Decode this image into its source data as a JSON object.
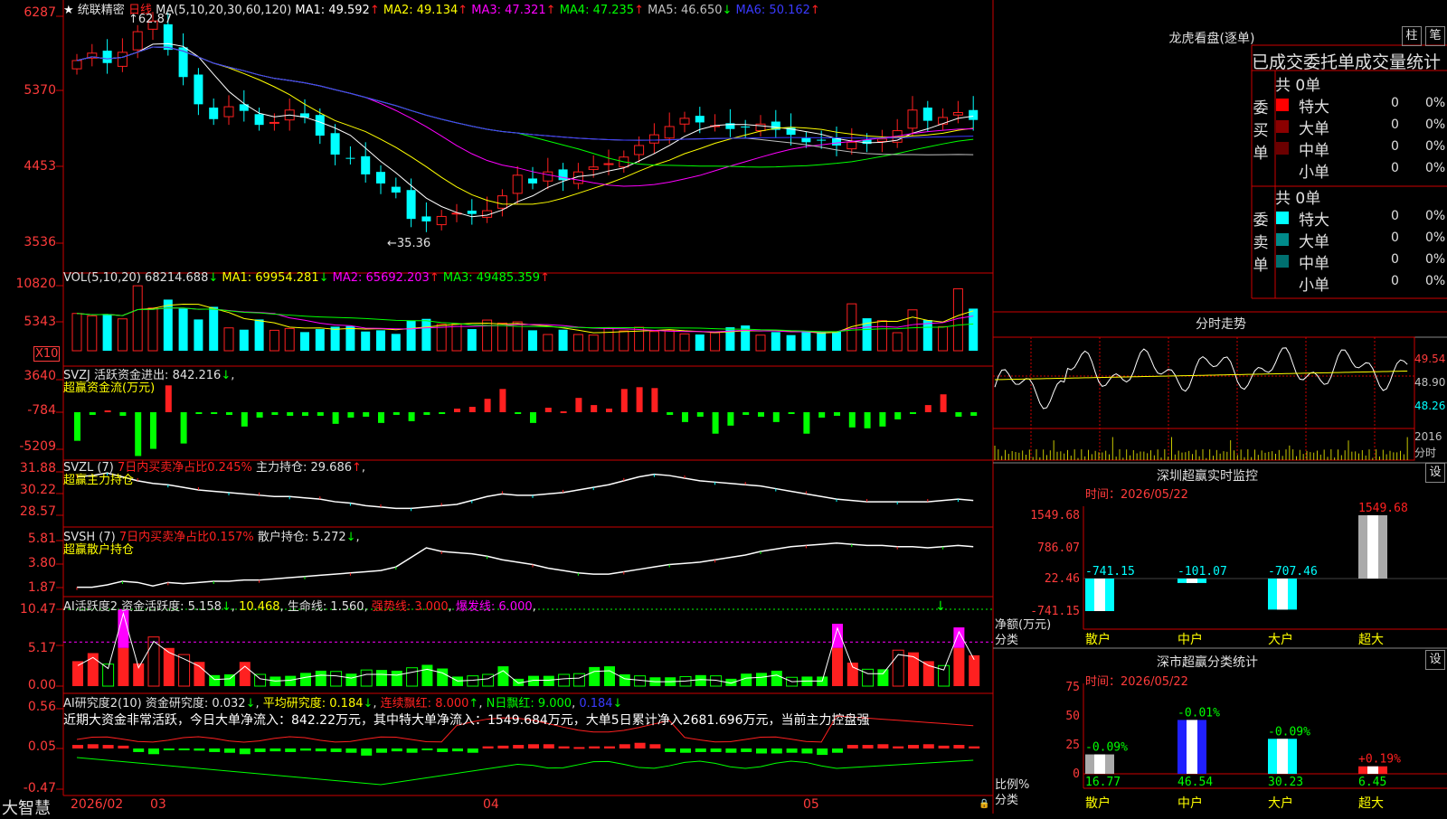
{
  "colors": {
    "up": "#ff2020",
    "down": "#00ffff",
    "green": "#00ff00",
    "grid": "#cc0000",
    "white": "#ffffff",
    "yellow": "#ffff00",
    "magenta": "#ff00ff",
    "blue": "#3a3aff"
  },
  "main": {
    "stock_name": "统联精密",
    "period": "日线",
    "ma_label": "MA(5,10,20,30,60,120)",
    "ma": [
      {
        "name": "MA1:",
        "value": "49.592",
        "arrow": "↑",
        "color": "#ffffff"
      },
      {
        "name": "MA2:",
        "value": "49.134",
        "arrow": "↑",
        "color": "#ffff00"
      },
      {
        "name": "MA3:",
        "value": "47.321",
        "arrow": "↑",
        "color": "#ff00ff"
      },
      {
        "name": "MA4:",
        "value": "47.235",
        "arrow": "↑",
        "color": "#00ff00"
      },
      {
        "name": "MA5:",
        "value": "46.650",
        "arrow": "↓",
        "color": "#c0c0c0"
      },
      {
        "name": "MA6:",
        "value": "50.162",
        "arrow": "↑",
        "color": "#3a3aff"
      }
    ],
    "high_label": "62.87",
    "low_label": "35.36",
    "yticks": [
      "6287",
      "5370",
      "4453",
      "3536"
    ]
  },
  "vol": {
    "label": "VOL(5,10,20)",
    "value": "68214.688",
    "arrow": "↓",
    "ma": [
      {
        "name": "MA1:",
        "value": "69954.281",
        "arrow": "↓",
        "color": "#ffff00"
      },
      {
        "name": "MA2:",
        "value": "65692.203",
        "arrow": "↑",
        "color": "#ff00ff"
      },
      {
        "name": "MA3:",
        "value": "49485.359",
        "arrow": "↑",
        "color": "#00ff00"
      }
    ],
    "yticks": [
      "10820",
      "5343"
    ],
    "unit": "X10"
  },
  "svzj": {
    "label": "SVZJ",
    "name": "活跃资金进出:",
    "value": "842.216",
    "arrow": "↓",
    "subtitle": "超赢资金流(万元)",
    "yticks": [
      "3640",
      "-784",
      "-5209"
    ]
  },
  "svzl": {
    "label": "SVZL (7)",
    "desc": "7日内买卖净占比0.245%",
    "name": "主力持仓:",
    "value": "29.686",
    "arrow": "↑",
    "subtitle": "超赢主力持仓",
    "yticks": [
      "31.88",
      "30.22",
      "28.57"
    ]
  },
  "svsh": {
    "label": "SVSH (7)",
    "desc": "7日内买卖净占比0.157%",
    "name": "散户持仓:",
    "value": "5.272",
    "arrow": "↓",
    "subtitle": "超赢散户持仓",
    "yticks": [
      "5.81",
      "3.80",
      "1.87"
    ]
  },
  "ai1": {
    "label": "AI活跃度2",
    "name": "资金活跃度:",
    "value": "5.158",
    "arrow": "↓",
    "value2": "10.468",
    "name3": "生命线:",
    "value3": "1.560",
    "name4": "强势线:",
    "value4": "3.000",
    "name5": "爆发线:",
    "value5": "6.000",
    "yticks": [
      "10.47",
      "5.17",
      "0.00"
    ]
  },
  "ai2": {
    "label": "AI研究度2(10)",
    "name": "资金研究度:",
    "value": "0.032",
    "arrow": "↓",
    "name2": "平均研究度:",
    "value2": "0.184",
    "name3": "连续飘红:",
    "value3": "8.000",
    "name4": "N日飘红:",
    "value4": "9.000",
    "value5": "0.184",
    "comment": "近期大资金非常活跃，今日大单净流入：842.22万元，其中特大单净流入：1549.684万元，大单5日累计净入2681.696万元，当前主力控盘强",
    "yticks": [
      "0.56",
      "0.05",
      "-0.47"
    ]
  },
  "xaxis": {
    "labels": [
      "2026/02",
      "03",
      "04",
      "05"
    ],
    "brand": "大智慧"
  },
  "dragon": {
    "title": "龙虎看盘(逐单)",
    "btn1": "柱",
    "btn2": "笔",
    "subtitle": "已成交委托单成交量统计",
    "buy": {
      "label": "委买单",
      "total": "共 0单",
      "rows": [
        {
          "name": "特大",
          "count": "0",
          "pct": "0%",
          "color": "#ff0000"
        },
        {
          "name": "大单",
          "count": "0",
          "pct": "0%",
          "color": "#8b0000"
        },
        {
          "name": "中单",
          "count": "0",
          "pct": "0%",
          "color": "#6b0000"
        },
        {
          "name": "小单",
          "count": "0",
          "pct": "0%",
          "color": "#000000"
        }
      ]
    },
    "sell": {
      "label": "委卖单",
      "total": "共 0单",
      "rows": [
        {
          "name": "特大",
          "count": "0",
          "pct": "0%",
          "color": "#00ffff"
        },
        {
          "name": "大单",
          "count": "0",
          "pct": "0%",
          "color": "#008b8b"
        },
        {
          "name": "中单",
          "count": "0",
          "pct": "0%",
          "color": "#007070"
        },
        {
          "name": "小单",
          "count": "0",
          "pct": "0%",
          "color": "#000000"
        }
      ]
    }
  },
  "intraday": {
    "title": "分时走势",
    "yticks": [
      "49.54",
      "48.90",
      "48.26"
    ],
    "vol_tick": "2016",
    "vol_unit": "分时"
  },
  "sz_monitor": {
    "title": "深圳超赢实时监控",
    "btn": "设",
    "time": "时间：2026/05/22",
    "yticks": [
      "1549.68",
      "786.07",
      "22.46",
      "-741.15"
    ],
    "ylabel": "净额(万元)",
    "xlabel": "分类",
    "chart_data": {
      "type": "bar",
      "categories": [
        "散户",
        "中户",
        "大户",
        "超大"
      ],
      "values": [
        -741.15,
        -101.07,
        -707.46,
        1549.68
      ],
      "ylim": [
        -741.15,
        1549.68
      ]
    }
  },
  "sz_class": {
    "title": "深市超赢分类统计",
    "btn": "设",
    "time": "时间：2026/05/22",
    "yticks": [
      "75",
      "50",
      "25",
      "0"
    ],
    "ylabel": "比例%",
    "xlabel": "分类",
    "chart_data": {
      "type": "bar",
      "categories": [
        "散户",
        "中户",
        "大户",
        "超大"
      ],
      "values": [
        16.77,
        46.54,
        30.23,
        6.45
      ],
      "changes": [
        "-0.09%",
        "-0.01%",
        "-0.09%",
        "+0.19%"
      ],
      "ylim": [
        0,
        75
      ]
    }
  }
}
